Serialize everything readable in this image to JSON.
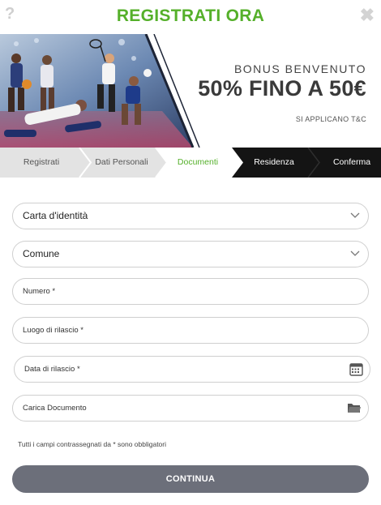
{
  "header": {
    "help_glyph": "?",
    "title": "REGISTRATI ORA",
    "close_glyph": "✖"
  },
  "banner": {
    "line1": "BONUS BENVENUTO",
    "line2": "50% FINO A 50€",
    "line3": "SI APPLICANO T&C"
  },
  "steps": [
    {
      "label": "Registrati",
      "state": "done"
    },
    {
      "label": "Dati Personali",
      "state": "done"
    },
    {
      "label": "Documenti",
      "state": "active"
    },
    {
      "label": "Residenza",
      "state": "todo"
    },
    {
      "label": "Conferma",
      "state": "todo"
    }
  ],
  "form": {
    "document_type": "Carta d'identità",
    "municipality": "Comune",
    "number_placeholder": "Numero *",
    "place_placeholder": "Luogo di rilascio *",
    "date_placeholder": "Data di rilascio *",
    "upload_placeholder": "Carica Documento"
  },
  "note": "Tutti i campi contrassegnati da * sono obbligatori",
  "continue_label": "CONTINUA",
  "colors": {
    "brand_green": "#55b02a",
    "step_done": "#e3e3e3",
    "step_active": "#ffffff",
    "step_todo": "#141414",
    "button": "#6c6f7a"
  },
  "icons": {
    "help": "question-icon",
    "close": "close-icon",
    "select": "chevron-down-icon",
    "date": "calendar-icon",
    "upload": "folder-icon"
  }
}
